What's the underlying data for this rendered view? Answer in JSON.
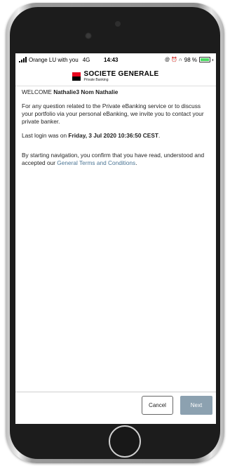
{
  "status_bar": {
    "carrier": "Orange LU with you",
    "network": "4G",
    "time": "14:43",
    "icons": "@ ⏰ ∩",
    "battery": "98 %"
  },
  "brand": {
    "name": "SOCIETE GENERALE",
    "subtitle": "Private Banking",
    "colors": {
      "red": "#e9041e",
      "black": "#000000"
    }
  },
  "welcome": {
    "prefix": "WELCOME ",
    "user": "Nathalie3 Nom Nathalie"
  },
  "info_text": "For any question related to the Private eBanking service or to discuss your portfolio via your personal eBanking, we invite you to contact your private banker.",
  "last_login": {
    "prefix": "Last login was on ",
    "value": "Friday, 3 Jul 2020 10:36:50 CEST",
    "suffix": "."
  },
  "terms": {
    "prefix": "By starting navigation, you confirm that you have read, understood and accepted our ",
    "link": "General Terms and Conditions",
    "suffix": "."
  },
  "buttons": {
    "cancel": "Cancel",
    "next": "Next"
  }
}
